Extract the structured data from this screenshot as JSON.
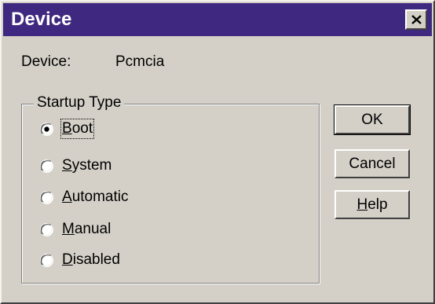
{
  "window": {
    "title": "Device",
    "title_bg": "#3f2980",
    "face_color": "#d4d0c8",
    "close_icon": "close-icon"
  },
  "device": {
    "label": "Device:",
    "value": "Pcmcia"
  },
  "startup_type": {
    "legend": "Startup Type",
    "selected": "Boot",
    "options": [
      {
        "label": "Boot",
        "mnemonic": "B",
        "rest": "oot",
        "checked": true
      },
      {
        "label": "System",
        "mnemonic": "S",
        "rest": "ystem",
        "checked": false
      },
      {
        "label": "Automatic",
        "mnemonic": "A",
        "rest": "utomatic",
        "checked": false
      },
      {
        "label": "Manual",
        "mnemonic": "M",
        "rest": "anual",
        "checked": false
      },
      {
        "label": "Disabled",
        "mnemonic": "D",
        "rest": "isabled",
        "checked": false
      }
    ]
  },
  "buttons": {
    "ok": "OK",
    "cancel": "Cancel",
    "help_mnemonic": "H",
    "help_rest": "elp"
  }
}
